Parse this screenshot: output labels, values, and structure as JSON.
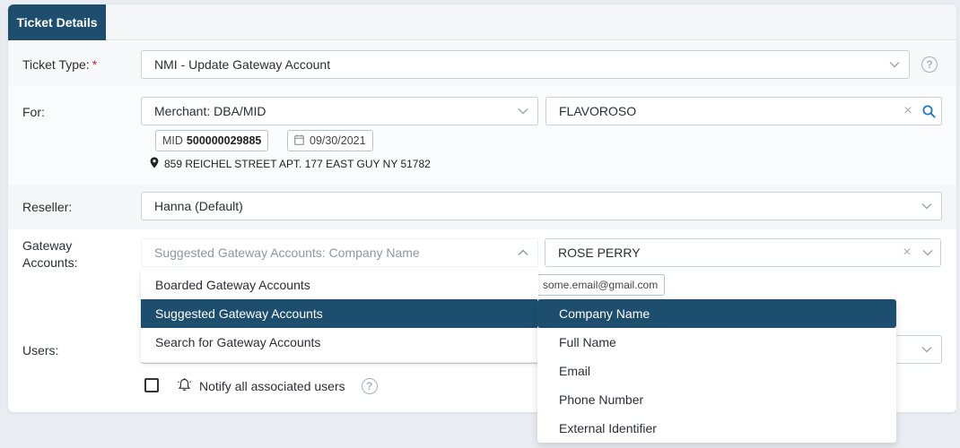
{
  "tabs": {
    "ticket_details": "Ticket Details"
  },
  "ticket_type": {
    "label": "Ticket Type:",
    "required_mark": "*",
    "value": "NMI - Update Gateway Account"
  },
  "for": {
    "label": "For:",
    "lookup_type": "Merchant: DBA/MID",
    "search_value": "FLAVOROSO",
    "mid_prefix": "MID",
    "mid_value": "500000029885",
    "date": "09/30/2021",
    "address": "859 REICHEL STREET APT. 177 EAST GUY NY 51782"
  },
  "reseller": {
    "label": "Reseller:",
    "value": "Hanna (Default)"
  },
  "gateway_accounts": {
    "label_line1": "Gateway",
    "label_line2": "Accounts:",
    "source_value": "Suggested Gateway Accounts: Company Name",
    "search_value": "ROSE PERRY",
    "email_chip": "some.email@gmail.com",
    "source_options": [
      "Boarded Gateway Accounts",
      "Suggested Gateway Accounts",
      "Search for Gateway Accounts"
    ],
    "field_options": [
      "Company Name",
      "Full Name",
      "Email",
      "Phone Number",
      "External Identifier"
    ]
  },
  "users": {
    "label": "Users:"
  },
  "notify": {
    "label": "Notify all associated users"
  },
  "icons": {
    "help": "?",
    "clear": "×"
  },
  "colors": {
    "accent": "#1d4e6e",
    "required": "#c0262d",
    "search_icon": "#1a73c9"
  }
}
